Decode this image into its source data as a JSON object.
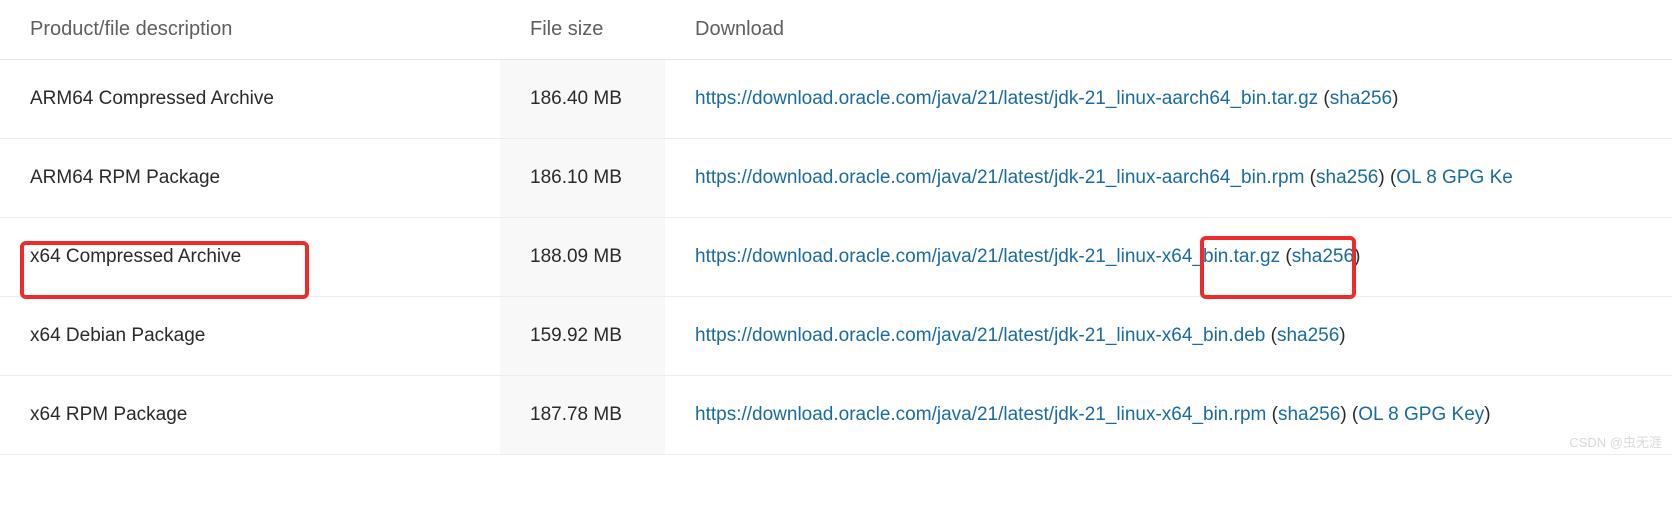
{
  "table": {
    "headers": {
      "description": "Product/file description",
      "size": "File size",
      "download": "Download"
    },
    "rows": [
      {
        "description": "ARM64 Compressed Archive",
        "size": "186.40 MB",
        "url": "https://download.oracle.com/java/21/latest/jdk-21_linux-aarch64_bin.tar.gz",
        "sha_label": "sha256",
        "gpg_label": ""
      },
      {
        "description": "ARM64 RPM Package",
        "size": "186.10 MB",
        "url": "https://download.oracle.com/java/21/latest/jdk-21_linux-aarch64_bin.rpm",
        "sha_label": "sha256",
        "gpg_label": "OL 8 GPG Ke"
      },
      {
        "description": "x64 Compressed Archive",
        "size": "188.09 MB",
        "url": "https://download.oracle.com/java/21/latest/jdk-21_linux-x64_bin.tar.gz",
        "sha_label": "sha256",
        "gpg_label": ""
      },
      {
        "description": "x64 Debian Package",
        "size": "159.92 MB",
        "url": "https://download.oracle.com/java/21/latest/jdk-21_linux-x64_bin.deb",
        "sha_label": "sha256",
        "gpg_label": ""
      },
      {
        "description": "x64 RPM Package",
        "size": "187.78 MB",
        "url": "https://download.oracle.com/java/21/latest/jdk-21_linux-x64_bin.rpm",
        "sha_label": "sha256",
        "gpg_label": "OL 8 GPG Key"
      }
    ]
  },
  "watermark": "CSDN @虫无涯"
}
